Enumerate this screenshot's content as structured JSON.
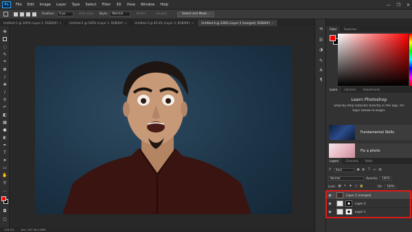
{
  "app": {
    "logo_text": "Ps"
  },
  "menu": [
    "File",
    "Edit",
    "Image",
    "Layer",
    "Type",
    "Select",
    "Filter",
    "3D",
    "View",
    "Window",
    "Help"
  ],
  "window_controls": [
    "—",
    "❐",
    "✕"
  ],
  "options_bar": {
    "feather_label": "Feather:",
    "feather_value": "0 px",
    "antialias_label": "Anti-alias",
    "style_label": "Style:",
    "style_value": "Normal",
    "width_label": "Width:",
    "height_label": "Height:",
    "select_mask_label": "Select and Mask..."
  },
  "doc_tabs": [
    {
      "label": "Untitled-1 @ 100% (Layer 1, RGB/8#)",
      "close": "×",
      "active": false
    },
    {
      "label": "Untitled-2 @ 100% (Layer 1, RGB/8#)",
      "close": "×",
      "active": false
    },
    {
      "label": "Untitled-3 @ 95.4% (Layer 3, RGB/8#)",
      "close": "×",
      "active": false
    },
    {
      "label": "Untitled-4 @ 228% (Layer 2 (merged), RGB/8#)",
      "close": "×",
      "active": true
    }
  ],
  "status": {
    "zoom": "228.4%",
    "doc": "Doc: 467.9K/1.86M"
  },
  "color_panel": {
    "tabs": [
      "Color",
      "Swatches"
    ],
    "foreground": "#ff0000",
    "background": "#000000"
  },
  "learn_panel": {
    "tabs": [
      "Learn",
      "Libraries",
      "Adjustments"
    ],
    "title": "Learn Photoshop",
    "subtitle_line1": "Step-by-step tutorials directly in the app. Pic",
    "subtitle_line2": "topic below to begin.",
    "cards": [
      "Fundamental Skills",
      "Fix a photo"
    ]
  },
  "layers_panel": {
    "tabs": [
      "Layers",
      "Channels",
      "Paths"
    ],
    "kind_label": "Kind",
    "blend_mode": "Normal",
    "opacity_label": "Opacity:",
    "opacity_value": "100%",
    "lock_label": "Lock:",
    "fill_label": "Fill:",
    "fill_value": "100%",
    "layers": [
      {
        "name": "Layer 2 (merged)",
        "selected": true
      },
      {
        "name": "Layer 2",
        "selected": false
      },
      {
        "name": "Layer 1",
        "selected": false
      }
    ]
  },
  "icons": {
    "eye": "eye-icon",
    "filter": "filter-icon",
    "lock": "lock-icon"
  },
  "colors": {
    "highlight_box": "#e01a1a",
    "accent": "#31a8ff"
  }
}
